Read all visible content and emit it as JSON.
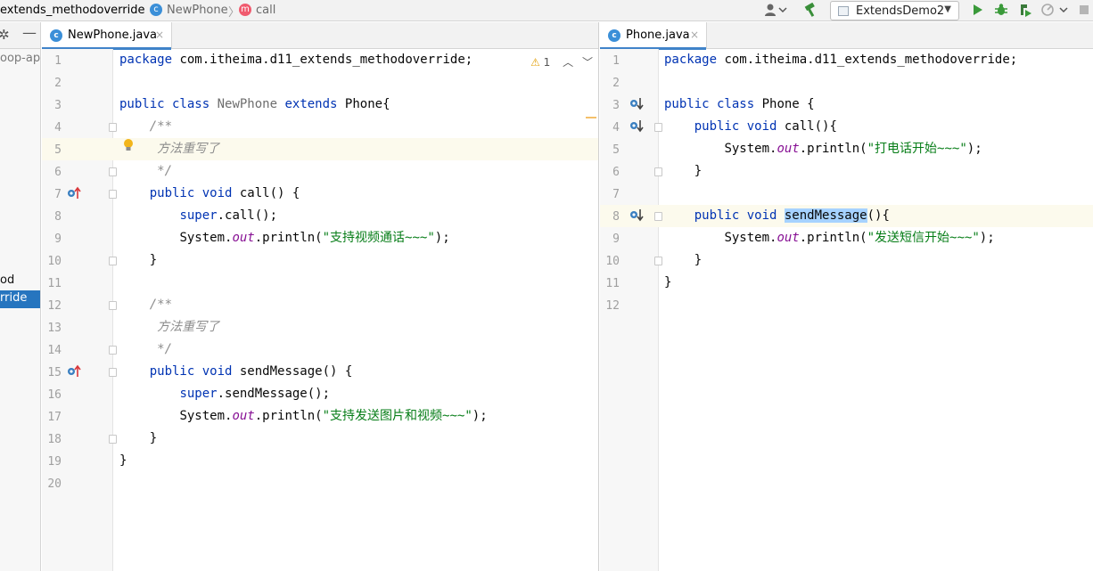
{
  "breadcrumb": {
    "package": "extends_methodoverride",
    "class": "NewPhone",
    "class_badge": "c",
    "method": "call",
    "method_badge": "m",
    "class_badge_color": "#3b8fd8",
    "method_badge_color": "#f05a6e"
  },
  "toolbar": {
    "user_icon": "user-icon",
    "build_icon": "hammer-icon",
    "run_config": "ExtendsDemo2",
    "run_icon": "run-icon",
    "debug_icon": "debug-icon",
    "coverage_icon": "coverage-icon",
    "profile_icon": "profile-icon",
    "stop_icon": "stop-icon"
  },
  "project_strip": {
    "settings_icon": "gear-icon",
    "collapse_icon": "minimize-icon",
    "visible_text": [
      "oop-app",
      "od",
      "rride"
    ]
  },
  "left_editor": {
    "tab_label": "NewPhone.java",
    "tab_icon": "c",
    "close_glyph": "×",
    "warning_count": "1",
    "highlighted_line": 5,
    "lines": [
      {
        "n": "1",
        "text": "package com.itheima.d11_extends_methodoverride;"
      },
      {
        "n": "2",
        "text": ""
      },
      {
        "n": "3",
        "text": "public class NewPhone extends Phone{"
      },
      {
        "n": "4",
        "text": "    /**"
      },
      {
        "n": "5",
        "text": "     方法重写了"
      },
      {
        "n": "6",
        "text": "     */"
      },
      {
        "n": "7",
        "text": "    public void call() {"
      },
      {
        "n": "8",
        "text": "        super.call();"
      },
      {
        "n": "9",
        "text": "        System.out.println(\"支持视频通话~~~\");"
      },
      {
        "n": "10",
        "text": "    }"
      },
      {
        "n": "11",
        "text": ""
      },
      {
        "n": "12",
        "text": "    /**"
      },
      {
        "n": "13",
        "text": "     方法重写了"
      },
      {
        "n": "14",
        "text": "     */"
      },
      {
        "n": "15",
        "text": "    public void sendMessage() {"
      },
      {
        "n": "16",
        "text": "        super.sendMessage();"
      },
      {
        "n": "17",
        "text": "        System.out.println(\"支持发送图片和视频~~~\");"
      },
      {
        "n": "18",
        "text": "    }"
      },
      {
        "n": "19",
        "text": "}"
      },
      {
        "n": "20",
        "text": ""
      }
    ]
  },
  "right_editor": {
    "tab_label": "Phone.java",
    "tab_icon": "c",
    "close_glyph": "×",
    "highlighted_line": 8,
    "selected_word": "sendMessage",
    "lines": [
      {
        "n": "1",
        "text": "package com.itheima.d11_extends_methodoverride;"
      },
      {
        "n": "2",
        "text": ""
      },
      {
        "n": "3",
        "text": "public class Phone {"
      },
      {
        "n": "4",
        "text": "    public void call(){"
      },
      {
        "n": "5",
        "text": "        System.out.println(\"打电话开始~~~\");"
      },
      {
        "n": "6",
        "text": "    }"
      },
      {
        "n": "7",
        "text": ""
      },
      {
        "n": "8",
        "text": "    public void sendMessage(){"
      },
      {
        "n": "9",
        "text": "        System.out.println(\"发送短信开始~~~\");"
      },
      {
        "n": "10",
        "text": "    }"
      },
      {
        "n": "11",
        "text": "}"
      },
      {
        "n": "12",
        "text": ""
      }
    ]
  },
  "colors": {
    "keyword": "#0033b3",
    "string": "#067d17",
    "static_field": "#871094",
    "comment": "#8c8c8c",
    "warning": "#e3a10b",
    "tab_underline": "#4083c9",
    "selection": "#a6d2ff",
    "caret_line": "#fcfaed"
  }
}
